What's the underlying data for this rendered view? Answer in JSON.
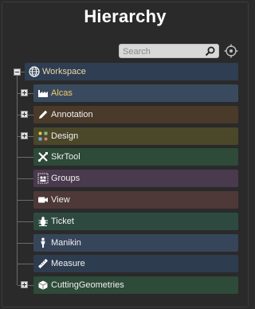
{
  "panel": {
    "title": "Hierarchy"
  },
  "search": {
    "placeholder": "Search",
    "value": ""
  },
  "tree": {
    "root": {
      "label": "Workspace",
      "icon": "globe-icon",
      "expanded": true,
      "color": "#2f3e52"
    },
    "items": [
      {
        "label": "Alcas",
        "icon": "factory-icon",
        "expandable": true,
        "color": "#3a4a5e"
      },
      {
        "label": "Annotation",
        "icon": "pencil-icon",
        "expandable": true,
        "color": "#4a3a2a"
      },
      {
        "label": "Design",
        "icon": "design-icon",
        "expandable": true,
        "color": "#4a4828"
      },
      {
        "label": "SkrTool",
        "icon": "tools-icon",
        "expandable": false,
        "color": "#2e4a38"
      },
      {
        "label": "Groups",
        "icon": "groups-icon",
        "expandable": false,
        "color": "#4a3a4e"
      },
      {
        "label": "View",
        "icon": "camera-icon",
        "expandable": false,
        "color": "#4e3838"
      },
      {
        "label": "Ticket",
        "icon": "bug-icon",
        "expandable": false,
        "color": "#2e4a40"
      },
      {
        "label": "Manikin",
        "icon": "person-icon",
        "expandable": false,
        "color": "#36455a"
      },
      {
        "label": "Measure",
        "icon": "ruler-icon",
        "expandable": false,
        "color": "#2e3c50"
      },
      {
        "label": "CuttingGeometries",
        "icon": "cube-icon",
        "expandable": true,
        "color": "#2e4a38"
      }
    ]
  }
}
